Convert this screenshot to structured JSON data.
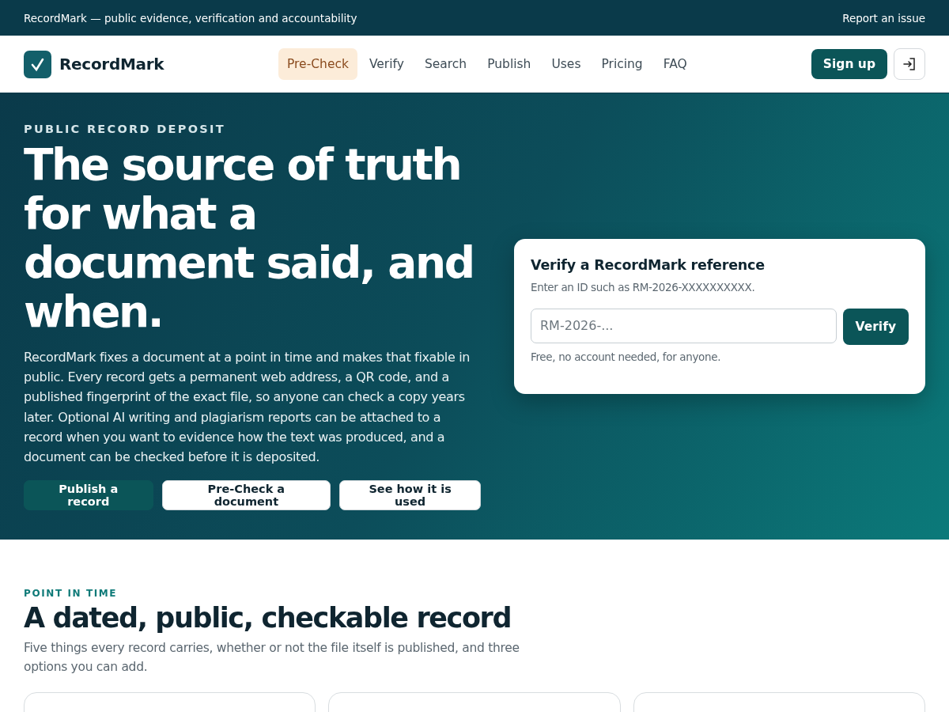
{
  "top_bar": {
    "tagline": "RecordMark — public evidence, verification and accountability",
    "link": "Report an issue"
  },
  "header": {
    "logo": "RecordMark",
    "nav": [
      {
        "label": "Pre-Check",
        "selected": true
      },
      {
        "label": "Verify",
        "selected": false
      },
      {
        "label": "Search",
        "selected": false
      },
      {
        "label": "Publish",
        "selected": false
      },
      {
        "label": "Uses",
        "selected": false
      },
      {
        "label": "Pricing",
        "selected": false
      },
      {
        "label": "FAQ",
        "selected": false
      }
    ],
    "signup": "Sign up"
  },
  "hero": {
    "eyebrow": "PUBLIC RECORD DEPOSIT",
    "title": "The source of truth for what a document said, and when.",
    "text": "RecordMark fixes a document at a point in time and makes that fixable in public. Every record gets a permanent web address, a QR code, and a published fingerprint of the exact file, so anyone can check a copy years later. Optional AI writing and plagiarism reports can be attached to a record when you want to evidence how the text was produced, and a document can be checked before it is deposited.",
    "buttons": [
      {
        "label": "Publish a record",
        "kind": "primary"
      },
      {
        "label": "Pre-Check a document",
        "kind": "secondary"
      },
      {
        "label": "See how it is used",
        "kind": "secondary"
      }
    ],
    "verify_card": {
      "title": "Verify a RecordMark reference",
      "hint": "Enter an ID such as RM-2026-XXXXXXXXXX.",
      "placeholder": "RM-2026-...",
      "button": "Verify",
      "note": "Free, no account needed, for anyone."
    }
  },
  "section": {
    "eyebrow": "POINT IN TIME",
    "title": "A dated, public, checkable record",
    "text": "Five things every record carries, whether or not the file itself is published, and three options you can add.",
    "cards": [
      {
        "kind": "card"
      },
      {
        "kind": "card"
      },
      {
        "kind": "card"
      }
    ]
  }
}
